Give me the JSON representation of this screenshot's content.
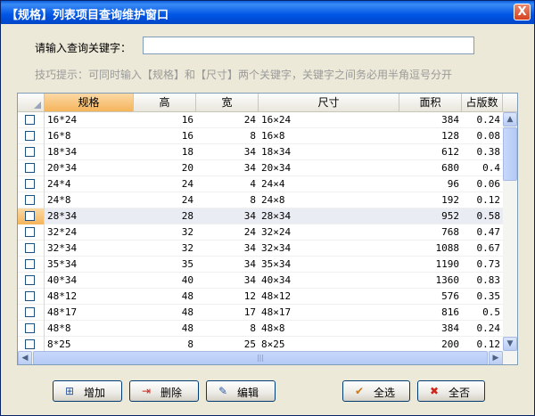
{
  "window": {
    "title": "【规格】列表项目查询维护窗口",
    "close_label": "X"
  },
  "search": {
    "label": "请输入查询关键字：",
    "value": "",
    "placeholder": ""
  },
  "hint": "技巧提示：可同时输入【规格】和【尺寸】两个关键字，关键字之间务必用半角逗号分开",
  "table": {
    "headers": [
      "规格",
      "高",
      "宽",
      "尺寸",
      "面积",
      "占版数"
    ],
    "sorted_column": "规格",
    "rows": [
      [
        "16*24",
        "16",
        "24",
        "16×24",
        "384",
        "0.24"
      ],
      [
        "16*8",
        "16",
        "8",
        "16×8",
        "128",
        "0.08"
      ],
      [
        "18*34",
        "18",
        "34",
        "18×34",
        "612",
        "0.38"
      ],
      [
        "20*34",
        "20",
        "34",
        "20×34",
        "680",
        "0.4"
      ],
      [
        "24*4",
        "24",
        "4",
        "24×4",
        "96",
        "0.06"
      ],
      [
        "24*8",
        "24",
        "8",
        "24×8",
        "192",
        "0.12"
      ],
      [
        "28*34",
        "28",
        "34",
        "28×34",
        "952",
        "0.58"
      ],
      [
        "32*24",
        "32",
        "24",
        "32×24",
        "768",
        "0.47"
      ],
      [
        "32*34",
        "32",
        "34",
        "32×34",
        "1088",
        "0.67"
      ],
      [
        "35*34",
        "35",
        "34",
        "35×34",
        "1190",
        "0.73"
      ],
      [
        "40*34",
        "40",
        "34",
        "40×34",
        "1360",
        "0.83"
      ],
      [
        "48*12",
        "48",
        "12",
        "48×12",
        "576",
        "0.35"
      ],
      [
        "48*17",
        "48",
        "17",
        "48×17",
        "816",
        "0.5"
      ],
      [
        "48*8",
        "48",
        "8",
        "48×8",
        "384",
        "0.24"
      ],
      [
        "8*25",
        "8",
        "25",
        "8×25",
        "200",
        "0.12"
      ]
    ],
    "highlighted_row": 6
  },
  "buttons": {
    "add": "增加",
    "delete": "删除",
    "edit": "编辑",
    "select_all": "全选",
    "deselect_all": "全否"
  },
  "colors": {
    "title_bar": "#0055e5",
    "sorted_header": "#f5b45b",
    "hint_text": "#9a9a9a"
  }
}
